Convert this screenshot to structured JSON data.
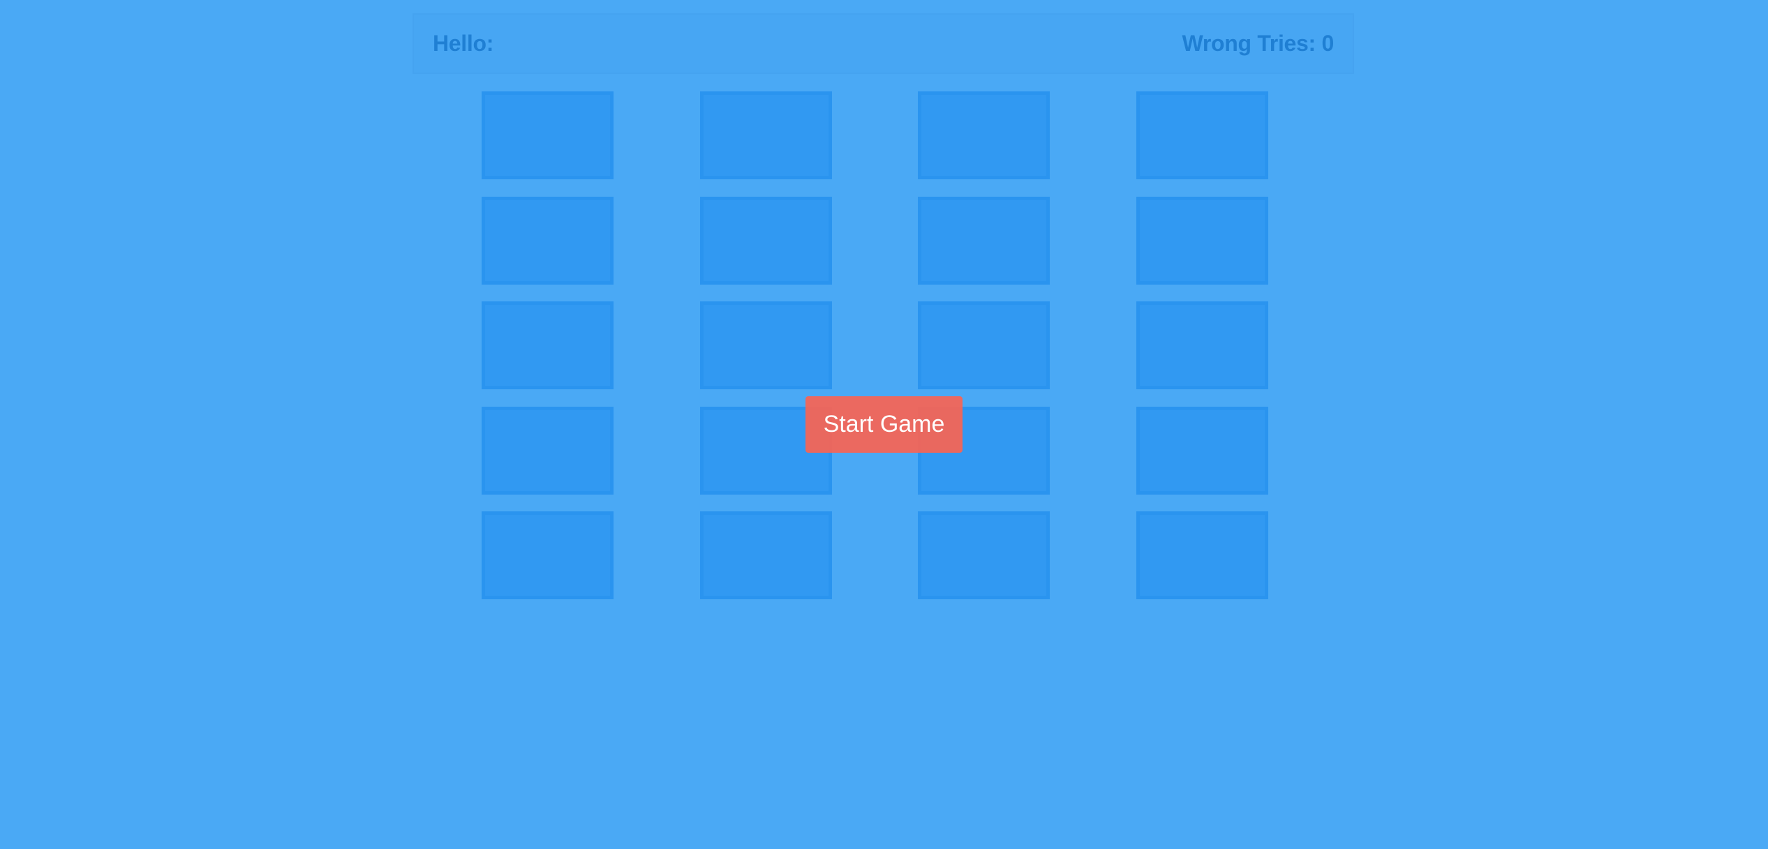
{
  "header": {
    "greeting_label": "Hello:",
    "player_name": "",
    "wrong_tries_label": "Wrong Tries:",
    "wrong_tries_count": "0"
  },
  "board": {
    "rows": 5,
    "columns": 4,
    "cards": [
      {
        "state": "face-down"
      },
      {
        "state": "face-down"
      },
      {
        "state": "face-down"
      },
      {
        "state": "face-down"
      },
      {
        "state": "face-down"
      },
      {
        "state": "face-down"
      },
      {
        "state": "face-down"
      },
      {
        "state": "face-down"
      },
      {
        "state": "face-down"
      },
      {
        "state": "face-down"
      },
      {
        "state": "face-down"
      },
      {
        "state": "face-down"
      },
      {
        "state": "face-down"
      },
      {
        "state": "face-down"
      },
      {
        "state": "face-down"
      },
      {
        "state": "face-down"
      },
      {
        "state": "face-down"
      },
      {
        "state": "face-down"
      },
      {
        "state": "face-down"
      },
      {
        "state": "face-down"
      }
    ]
  },
  "start_button": {
    "label": "Start Game"
  },
  "colors": {
    "background": "#4aa9f5",
    "card": "#3199f2",
    "card_border": "#2a94ef",
    "header_text": "#1f7fd3",
    "start_button": "#f86454"
  }
}
